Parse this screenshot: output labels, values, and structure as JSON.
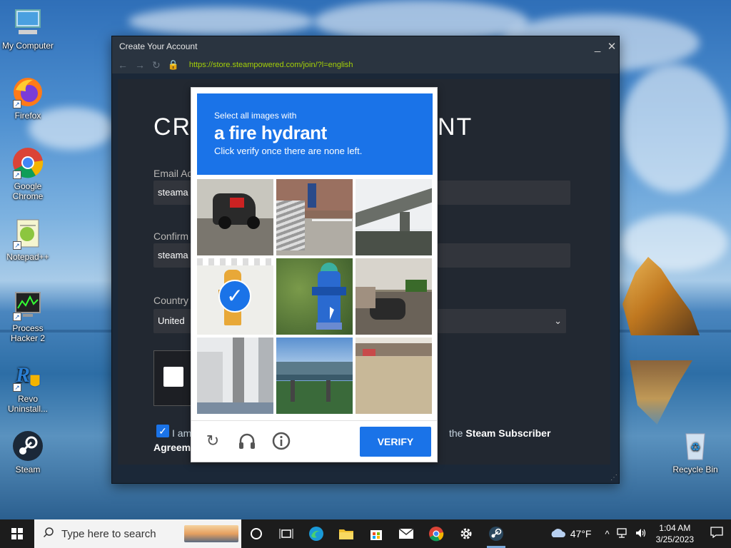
{
  "desktop": {
    "icons": [
      {
        "label": "My Computer"
      },
      {
        "label": "Firefox"
      },
      {
        "label": "Google Chrome"
      },
      {
        "label": "Notepad++"
      },
      {
        "label": "Process Hacker 2"
      },
      {
        "label": "Revo Uninstall..."
      },
      {
        "label": "Steam"
      },
      {
        "label": "Recycle Bin"
      }
    ]
  },
  "window": {
    "title": "Create Your Account",
    "url": "https://store.steampowered.com/join/?l=english",
    "minimize": "_",
    "close": "✕"
  },
  "form": {
    "heading_left": "CRE",
    "heading_right": "NT",
    "email_label": "Email Ad",
    "email_value": "steama",
    "confirm_label": "Confirm",
    "confirm_value": "steama",
    "country_label": "Country",
    "country_value": "United",
    "agree_text_start": "I am",
    "agree_text_mid": "the",
    "agree_link": "Steam Subscriber",
    "agree_link_2": "Agreem"
  },
  "captcha": {
    "instruction_small": "Select all images with",
    "target": "a fire hydrant",
    "instruction_sub": "Click verify once there are none left.",
    "verify_label": "VERIFY",
    "tiles": [
      {
        "subject": "motorcycles",
        "selected": false
      },
      {
        "subject": "building-stairs",
        "selected": false
      },
      {
        "subject": "overpass",
        "selected": false
      },
      {
        "subject": "fire-hydrant-yellow",
        "selected": true
      },
      {
        "subject": "fire-hydrant-blue",
        "selected": false
      },
      {
        "subject": "motorcycle-debris",
        "selected": false
      },
      {
        "subject": "utility-pole",
        "selected": false
      },
      {
        "subject": "bridge",
        "selected": false
      },
      {
        "subject": "street",
        "selected": false
      }
    ]
  },
  "taskbar": {
    "search_placeholder": "Type here to search",
    "temperature": "47°F",
    "time": "1:04 AM",
    "date": "3/25/2023"
  },
  "colors": {
    "captcha_blue": "#1a73e8",
    "steam_bg": "#1b2838",
    "url_green": "#a4d007"
  }
}
